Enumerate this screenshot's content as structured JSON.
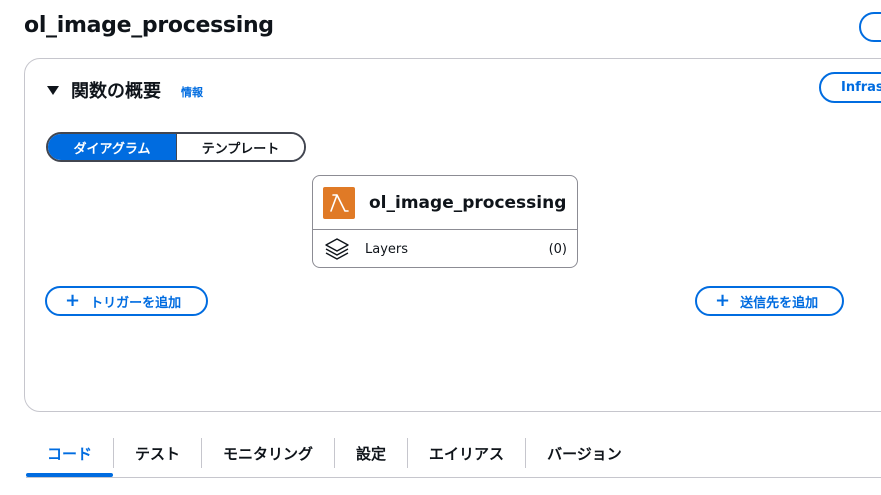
{
  "page": {
    "title": "ol_image_processing"
  },
  "overview": {
    "title": "関数の概要",
    "info_label": "情報",
    "infra_button_label": "Infrast",
    "view_toggle": {
      "options": [
        "ダイアグラム",
        "テンプレート"
      ],
      "selected": "ダイアグラム"
    },
    "function_card": {
      "name": "ol_image_processing",
      "icon": "lambda-icon",
      "layers_label": "Layers",
      "layers_count": "(0)"
    },
    "add_trigger_label": "トリガーを追加",
    "add_destination_label": "送信先を追加"
  },
  "tabs": [
    {
      "label": "コード",
      "active": true
    },
    {
      "label": "テスト",
      "active": false
    },
    {
      "label": "モニタリング",
      "active": false
    },
    {
      "label": "設定",
      "active": false
    },
    {
      "label": "エイリアス",
      "active": false
    },
    {
      "label": "バージョン",
      "active": false
    }
  ],
  "colors": {
    "accent": "#006ce0",
    "lambda_orange": "#e07a26",
    "border": "#c6c6cd",
    "text": "#0f141a"
  }
}
